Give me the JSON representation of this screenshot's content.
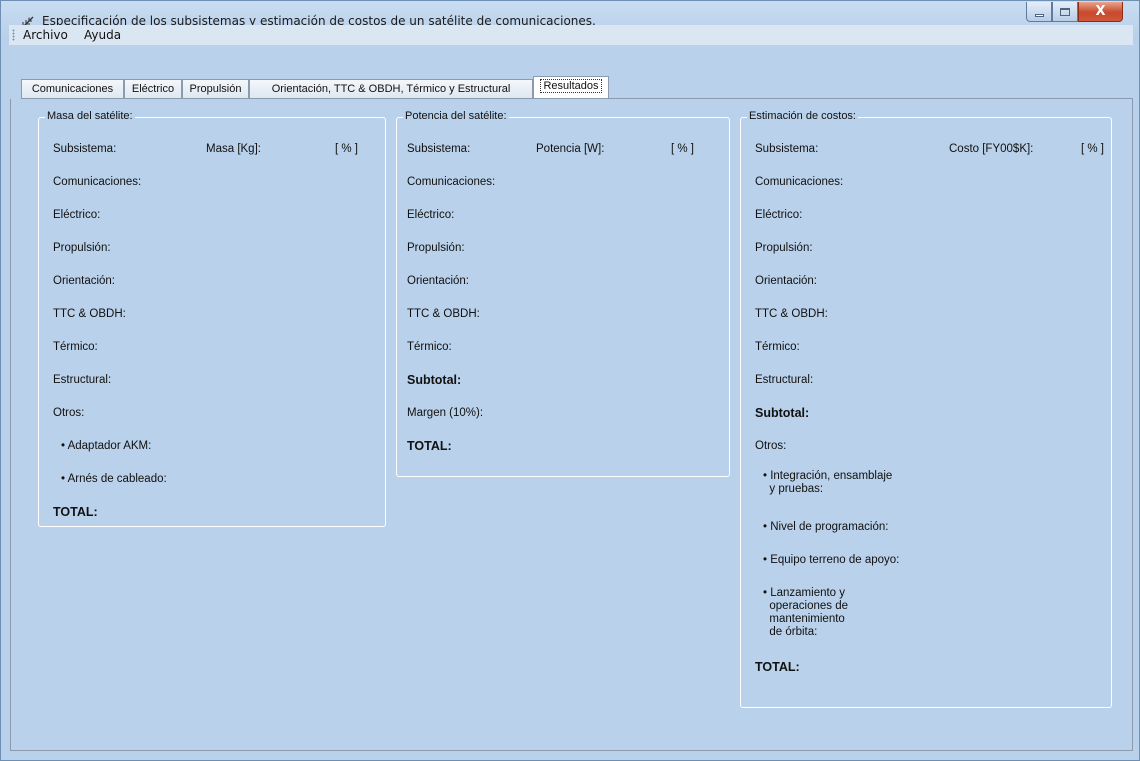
{
  "window": {
    "title": "Especificación de los subsistemas y estimación de costos de un satélite de comunicaciones.",
    "controls": {
      "minimize": "—",
      "maximize": "□",
      "close": "X"
    }
  },
  "menu": {
    "items": [
      "Archivo",
      "Ayuda"
    ]
  },
  "tabs": {
    "items": [
      "Comunicaciones",
      "Eléctrico",
      "Propulsión",
      "Orientación, TTC & OBDH, Térmico y Estructural",
      "Resultados"
    ],
    "active_index": 4
  },
  "masa": {
    "title": "Masa del satélite:",
    "header": {
      "subsistema": "Subsistema:",
      "valor": "Masa [Kg]:",
      "porcentaje": "[ % ]"
    },
    "rows": [
      "Comunicaciones:",
      "Eléctrico:",
      "Propulsión:",
      "Orientación:",
      "TTC & OBDH:",
      "Térmico:",
      "Estructural:",
      "Otros:"
    ],
    "otros": [
      "• Adaptador AKM:",
      "• Arnés de cableado:"
    ],
    "total": "TOTAL:"
  },
  "potencia": {
    "title": "Potencia del satélite:",
    "header": {
      "subsistema": "Subsistema:",
      "valor": "Potencia [W]:",
      "porcentaje": "[ % ]"
    },
    "rows": [
      "Comunicaciones:",
      "Eléctrico:",
      "Propulsión:",
      "Orientación:",
      "TTC & OBDH:",
      "Térmico:"
    ],
    "subtotal": "Subtotal:",
    "margen": "Margen (10%):",
    "total": "TOTAL:"
  },
  "costos": {
    "title": "Estimación de costos:",
    "header": {
      "subsistema": "Subsistema:",
      "valor": "Costo [FY00$K]:",
      "porcentaje": "[ % ]"
    },
    "rows": [
      "Comunicaciones:",
      "Eléctrico:",
      "Propulsión:",
      "Orientación:",
      "TTC & OBDH:",
      "Térmico:",
      "Estructural:"
    ],
    "subtotal": "Subtotal:",
    "otros_label": "Otros:",
    "otros": [
      {
        "lines": [
          "• Integración, ensamblaje",
          "  y pruebas:"
        ]
      },
      {
        "lines": [
          "• Nivel de programación:"
        ]
      },
      {
        "lines": [
          "• Equipo terreno de apoyo:"
        ]
      },
      {
        "lines": [
          "• Lanzamiento y",
          "  operaciones de",
          "  mantenimiento",
          "  de órbita:"
        ]
      }
    ],
    "total": "TOTAL:"
  },
  "colors": {
    "background": "#b9d1ea",
    "titlebar": "#c3d8f0",
    "close_button": "#c74a2b"
  }
}
